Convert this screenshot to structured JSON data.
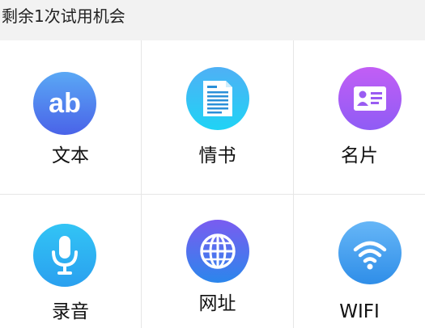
{
  "header": {
    "remaining_text": "剩余1次试用机会"
  },
  "grid": {
    "items": [
      {
        "label": "文本",
        "icon": "text-ab-icon",
        "color_top": "#5aa8f5",
        "color_bottom": "#4a63e8"
      },
      {
        "label": "情书",
        "icon": "document-icon",
        "color_top": "#4fb0f5",
        "color_bottom": "#1fd3f5"
      },
      {
        "label": "名片",
        "icon": "business-card-icon",
        "color_top": "#c25ef5",
        "color_bottom": "#8f5cf5"
      },
      {
        "label": "录音",
        "icon": "microphone-icon",
        "color_top": "#32c4f5",
        "color_bottom": "#2aa0ef"
      },
      {
        "label": "网址",
        "icon": "globe-icon",
        "color_top": "#7a5cf0",
        "color_bottom": "#2b86ec"
      },
      {
        "label": "WIFI",
        "icon": "wifi-icon",
        "color_top": "#66b6f7",
        "color_bottom": "#2f8ee8"
      }
    ]
  }
}
